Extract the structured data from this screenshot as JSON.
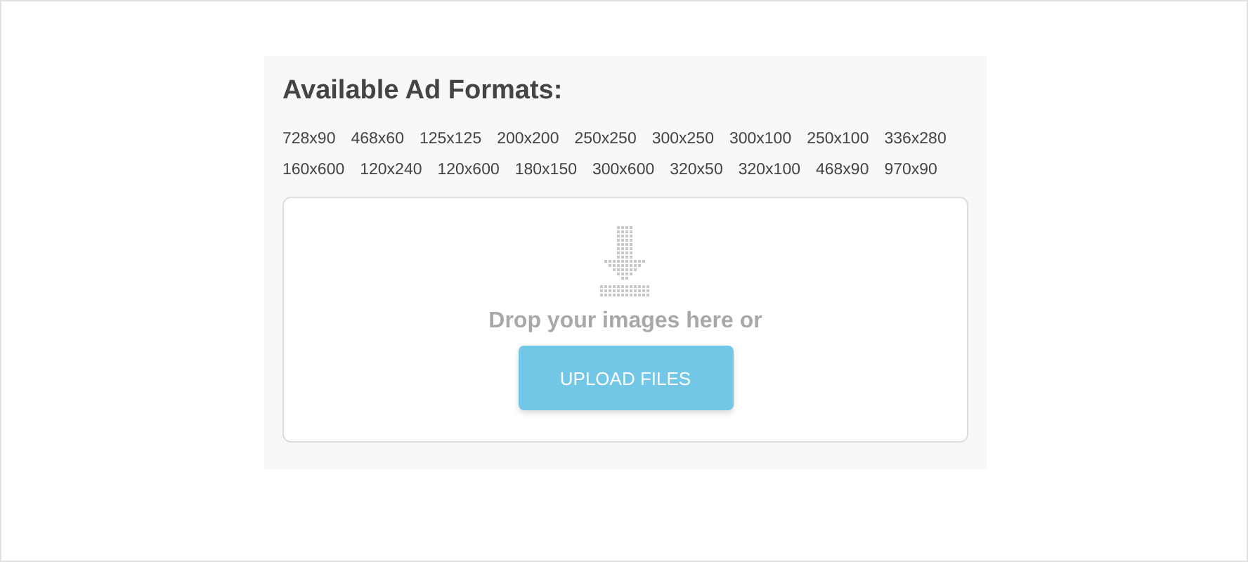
{
  "panel": {
    "title": "Available Ad Formats:",
    "formats": [
      "728x90",
      "468x60",
      "125x125",
      "200x200",
      "250x250",
      "300x250",
      "300x100",
      "250x100",
      "336x280",
      "160x600",
      "120x240",
      "120x600",
      "180x150",
      "300x600",
      "320x50",
      "320x100",
      "468x90",
      "970x90"
    ]
  },
  "dropzone": {
    "prompt": "Drop your images here or",
    "button": "UPLOAD FILES"
  }
}
